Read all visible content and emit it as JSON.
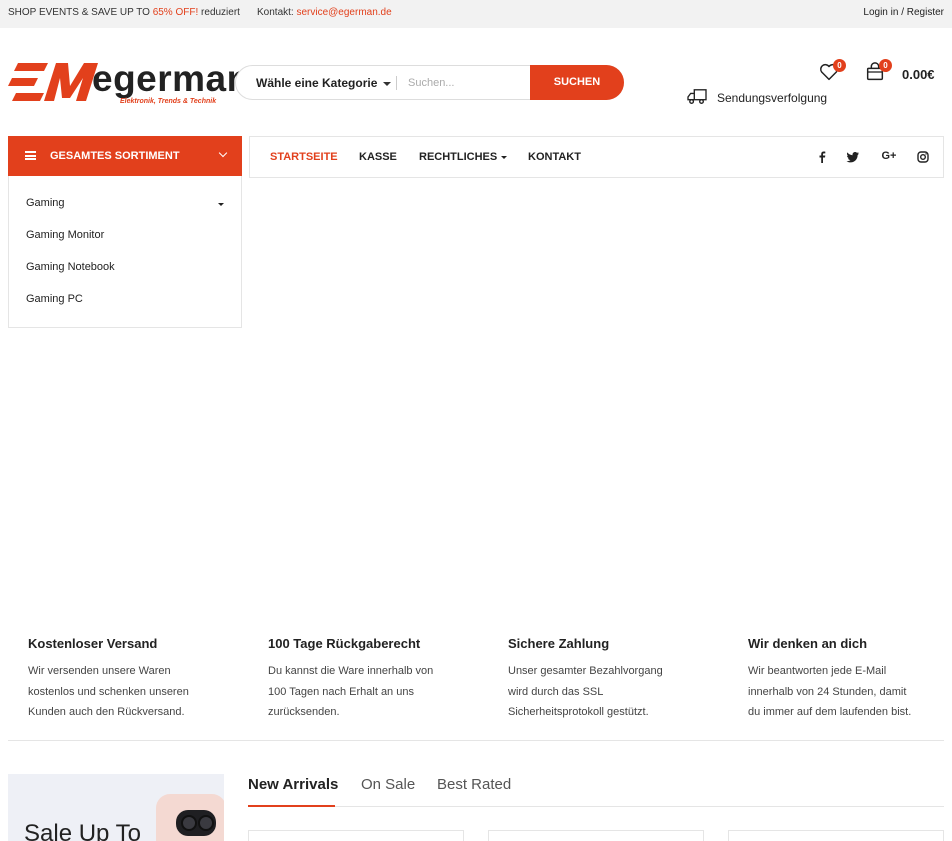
{
  "topbar": {
    "promo_prefix": "SHOP EVENTS & SAVE UP TO",
    "promo_highlight": "65% OFF!",
    "promo_suffix": "reduziert",
    "contact_label": "Kontakt:",
    "contact_email": "service@egerman.de",
    "login": "Login in / Register"
  },
  "logo": {
    "word": "egerman",
    "tagline": "Elektronik, Trends & Technik",
    "brand_color": "#e2401c"
  },
  "search": {
    "category": "Wähle eine Kategorie",
    "placeholder": "Suchen...",
    "button": "SUCHEN"
  },
  "header": {
    "wishlist_count": "0",
    "cart_count": "0",
    "cart_total": "0.00€",
    "tracking": "Sendungsverfolgung"
  },
  "nav": {
    "all_categories": "GESAMTES SORTIMENT",
    "items": [
      "STARTSEITE",
      "KASSE",
      "RECHTLICHES",
      "KONTAKT"
    ],
    "social": [
      "f",
      "t",
      "G+",
      "ig"
    ]
  },
  "sidebar": {
    "items": [
      "Gaming",
      "Gaming Monitor",
      "Gaming Notebook",
      "Gaming PC"
    ]
  },
  "features": [
    {
      "title": "Kostenloser Versand",
      "lines": [
        "Wir versenden unsere Waren",
        "kostenlos und schenken unseren",
        "Kunden auch den Rückversand."
      ]
    },
    {
      "title": "100 Tage Rückgaberecht",
      "lines": [
        "Du kannst die Ware innerhalb von",
        "100 Tagen nach Erhalt an uns",
        "zurücksenden."
      ]
    },
    {
      "title": "Sichere Zahlung",
      "lines": [
        "Unser gesamter Bezahlvorgang",
        "wird durch das SSL",
        "Sicherheitsprotokoll gestützt."
      ]
    },
    {
      "title": "Wir denken an dich",
      "lines": [
        "Wir beantworten jede E-Mail",
        "innerhalb von 24 Stunden, damit",
        "du immer auf dem laufenden bist."
      ]
    }
  ],
  "banner": {
    "text": "Sale Up To"
  },
  "tabs": [
    "New Arrivals",
    "On Sale",
    "Best Rated"
  ]
}
